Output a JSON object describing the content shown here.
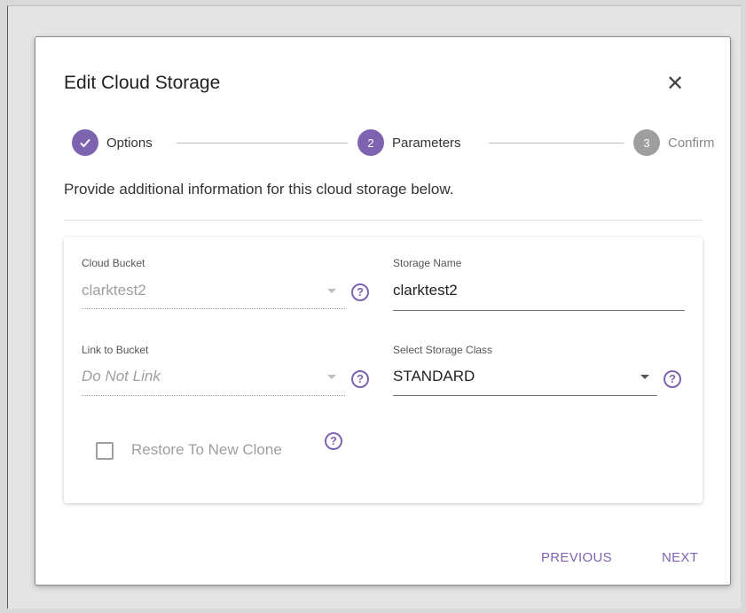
{
  "colors": {
    "accent": "#7e63b0",
    "step_inactive": "#9e9e9e",
    "disabled_text": "#9e9e9e"
  },
  "dialog": {
    "title": "Edit Cloud Storage",
    "close_icon": "close-icon",
    "subtitle": "Provide additional information for this cloud storage below."
  },
  "stepper": {
    "steps": [
      {
        "number": "1",
        "label": "Options",
        "state": "completed",
        "icon": "check-icon"
      },
      {
        "number": "2",
        "label": "Parameters",
        "state": "active"
      },
      {
        "number": "3",
        "label": "Confirm",
        "state": "inactive"
      }
    ]
  },
  "form": {
    "cloud_bucket": {
      "label": "Cloud Bucket",
      "value": "clarktest2",
      "disabled": true
    },
    "storage_name": {
      "label": "Storage Name",
      "value": "clarktest2"
    },
    "link_to_bucket": {
      "label": "Link to Bucket",
      "value": "Do Not Link",
      "disabled": true
    },
    "storage_class": {
      "label": "Select Storage Class",
      "value": "STANDARD"
    },
    "restore_clone": {
      "label": "Restore To New Clone",
      "checked": false,
      "disabled": true
    },
    "help_icon": "help-circle-icon"
  },
  "actions": {
    "previous": "PREVIOUS",
    "next": "NEXT"
  }
}
